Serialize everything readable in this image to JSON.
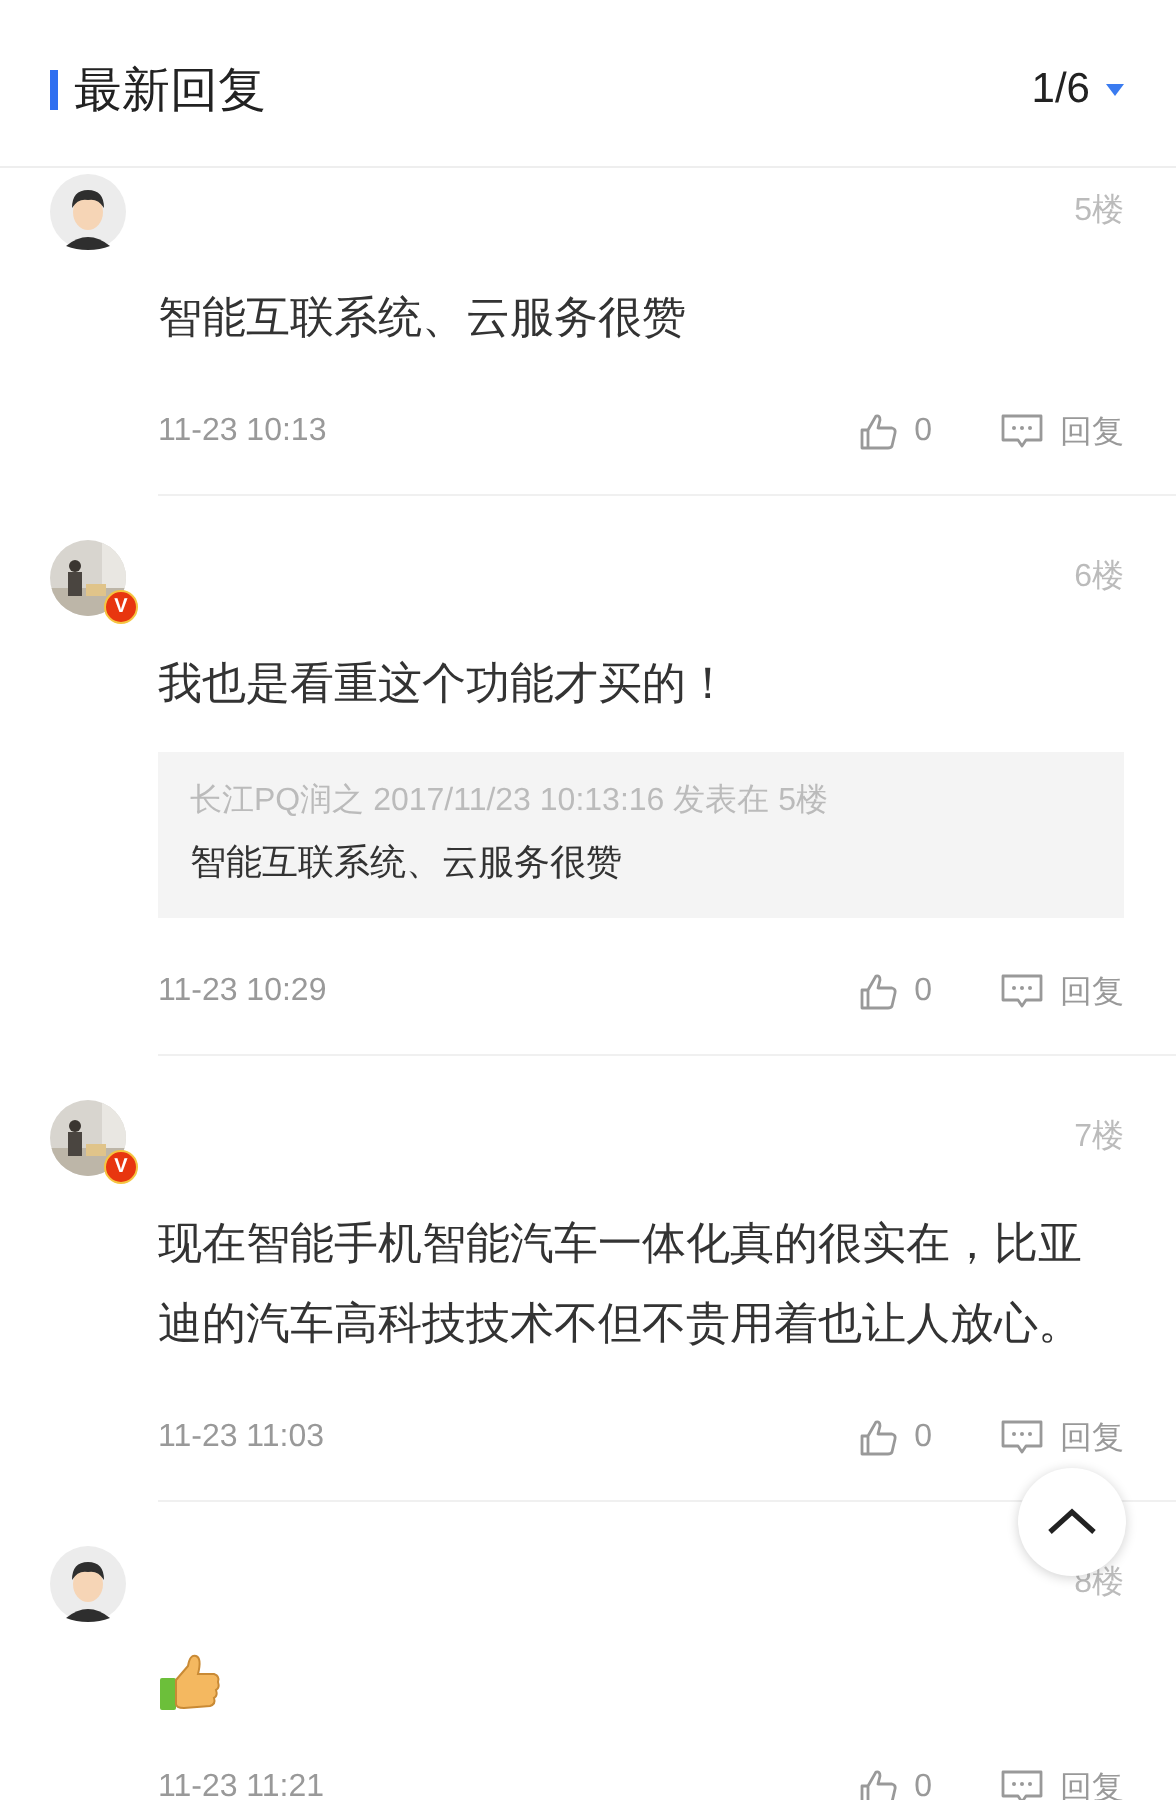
{
  "header": {
    "title": "最新回复",
    "page": "1/6"
  },
  "replies": [
    {
      "avatar": {
        "kind": "cartoon"
      },
      "floor": "5楼",
      "content": {
        "kind": "text",
        "text": "智能互联系统、云服务很赞"
      },
      "time": "11-23 10:13",
      "likes": "0",
      "reply_label": "回复"
    },
    {
      "badge": "V",
      "floor": "6楼",
      "content": {
        "kind": "text",
        "text": "我也是看重这个功能才买的！"
      },
      "quote": {
        "meta": "长江PQ润之 2017/11/23 10:13:16 发表在 5楼",
        "text": "智能互联系统、云服务很赞"
      },
      "time": "11-23 10:29",
      "likes": "0",
      "reply_label": "回复"
    },
    {
      "badge": "V",
      "floor": "7楼",
      "content": {
        "kind": "text",
        "text": "现在智能手机智能汽车一体化真的很实在，比亚迪的汽车高科技技术不但不贵用着也让人放心。"
      },
      "time": "11-23 11:03",
      "likes": "0",
      "reply_label": "回复"
    },
    {
      "avatar": {
        "kind": "cartoon"
      },
      "floor": "8楼",
      "content": {
        "kind": "emoji"
      },
      "time": "11-23 11:21",
      "likes": "0",
      "reply_label": "回复"
    }
  ]
}
